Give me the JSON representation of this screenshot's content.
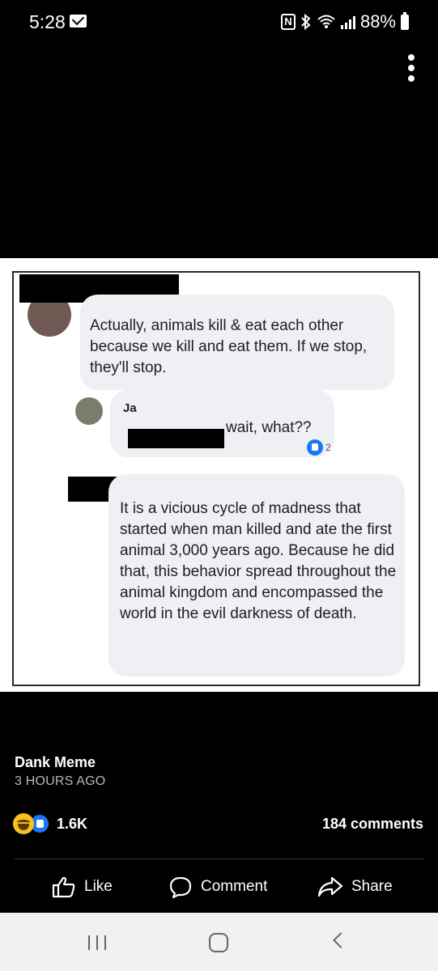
{
  "status_bar": {
    "time": "5:28",
    "battery": "88%",
    "icons": [
      "mail-icon",
      "nfc-icon",
      "bluetooth-icon",
      "wifi-icon",
      "signal-icon",
      "battery-icon"
    ]
  },
  "meme": {
    "comment1": "Actually, animals kill & eat each other because we kill and eat them. If we stop, they'll stop.",
    "reply_name_fragment": "Ja",
    "reply_text": "wait, what??",
    "reply_likes": "2",
    "comment2": "It is a vicious cycle of madness that started when man killed and ate the first animal 3,000 years ago. Because he did that, this behavior spread throughout the animal kingdom and encompassed the world in the evil darkness of death."
  },
  "post": {
    "page_name": "Dank Meme",
    "time_ago": "3 HOURS AGO",
    "reaction_count": "1.6K",
    "comments_count": "184 comments"
  },
  "actions": {
    "like": "Like",
    "comment": "Comment",
    "share": "Share"
  },
  "colors": {
    "facebook_blue": "#1877f2",
    "haha_yellow": "#f7c21c",
    "bubble_bg": "#eef0f3"
  }
}
